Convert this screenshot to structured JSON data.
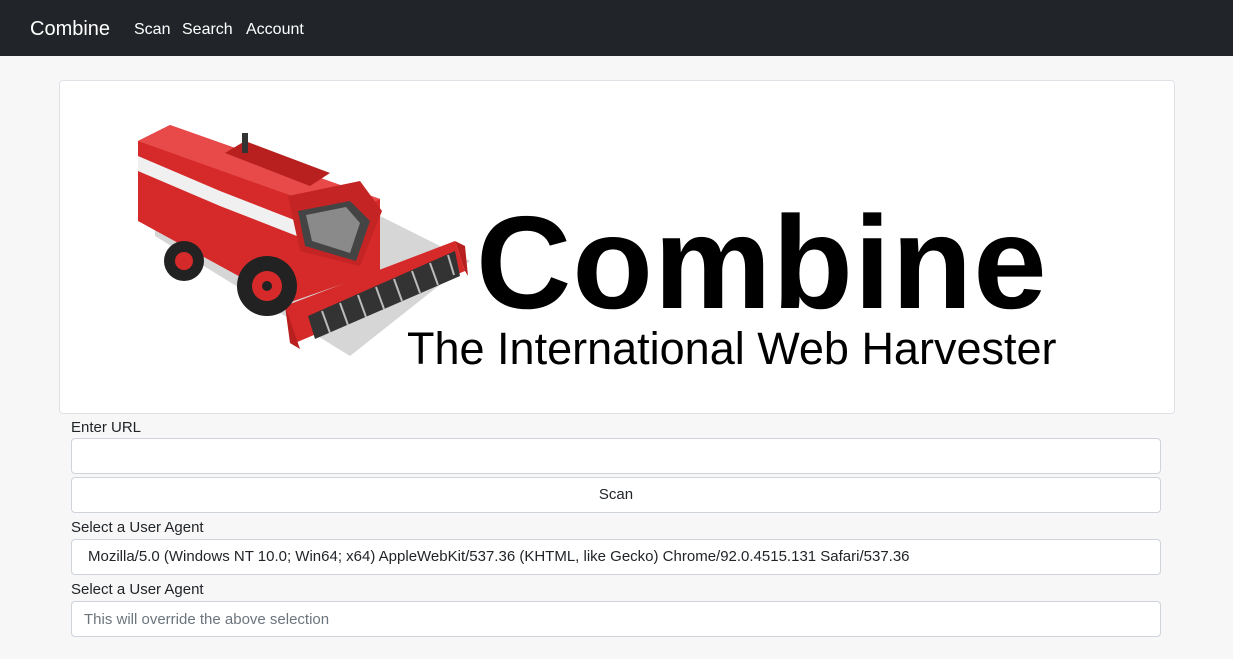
{
  "navbar": {
    "brand": "Combine",
    "links": [
      "Scan",
      "Search",
      "Account"
    ]
  },
  "banner": {
    "logo_word": "Combine",
    "tagline": "The International Web Harvester"
  },
  "form": {
    "url_label": "Enter URL",
    "url_value": "",
    "scan_label": "Scan",
    "user_agent_label": "Select a User Agent",
    "user_agent_selected": "Mozilla/5.0 (Windows NT 10.0; Win64; x64) AppleWebKit/537.36 (KHTML, like Gecko) Chrome/92.0.4515.131 Safari/537.36",
    "custom_agent_label": "Select a User Agent",
    "custom_agent_placeholder": "This will override the above selection"
  },
  "colors": {
    "navbar_bg": "#212529",
    "page_bg": "#f7f7f7",
    "harvester_red": "#d62a2a"
  }
}
